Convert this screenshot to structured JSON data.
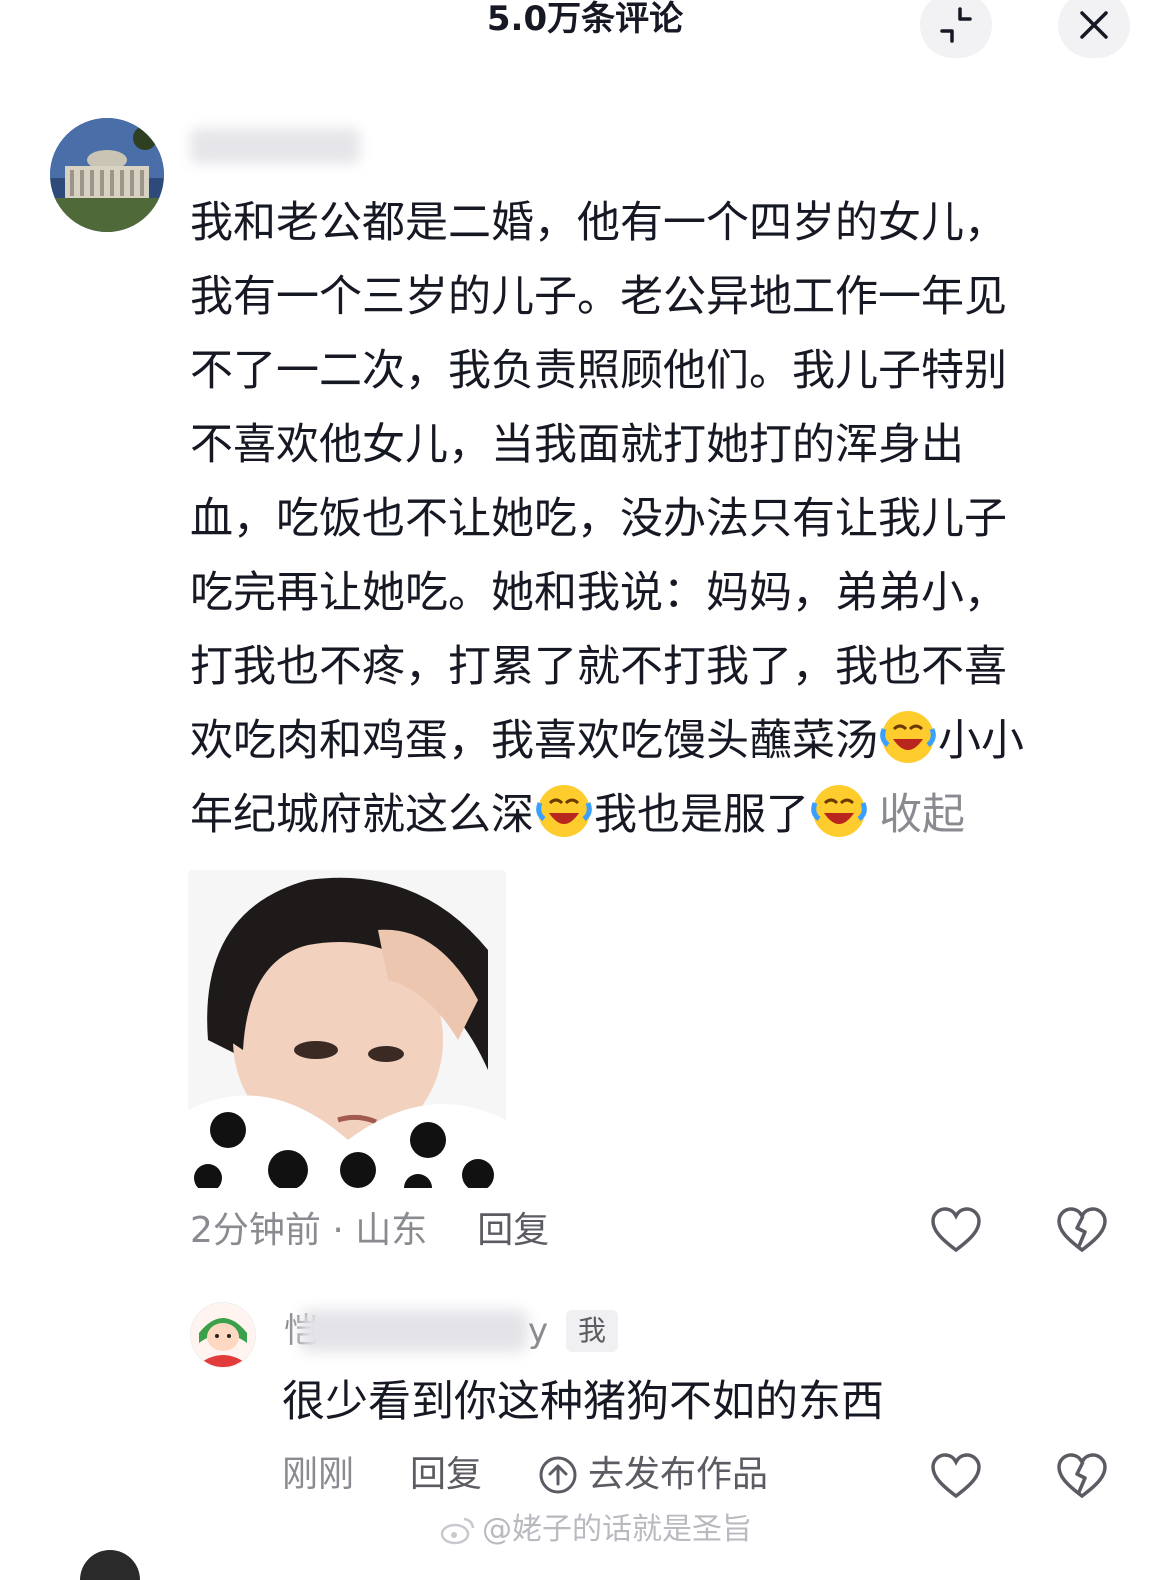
{
  "header": {
    "title": "5.0万条评论",
    "collapse_icon": "collapse-icon",
    "close_icon": "close-icon"
  },
  "comment1": {
    "username": "",
    "lines": [
      "我和老公都是二婚，他有一个四岁的女儿，",
      "我有一个三岁的儿子。老公异地工作一年见",
      "不了一二次，我负责照顾他们。我儿子特别",
      "不喜欢他女儿，当我面就打她打的浑身出",
      "血，吃饭也不让她吃，没办法只有让我儿子",
      "吃完再让她吃。她和我说：妈妈，弟弟小，",
      "打我也不疼，打累了就不打我了，我也不喜"
    ],
    "line8_a": "欢吃肉和鸡蛋，我喜欢吃馒头蘸菜汤",
    "line8_b": "小小",
    "line9_a": "年纪城府就这么深",
    "line9_b": "我也是服了",
    "collapse_label": "收起",
    "emoji": "laugh-cry-emoji",
    "time_location": "2分钟前 · 山东",
    "reply_label": "回复"
  },
  "comment2": {
    "name_start": "恺",
    "name_end": "y",
    "me_badge": "我",
    "text": "很少看到你这种猪狗不如的东西",
    "time": "刚刚",
    "reply_label": "回复",
    "publish_label": "去发布作品"
  },
  "watermark": "@姥子的话就是圣旨",
  "colors": {
    "text": "#161823",
    "secondary": "#8a8b91",
    "muted_button_bg": "#f2f2f4"
  }
}
